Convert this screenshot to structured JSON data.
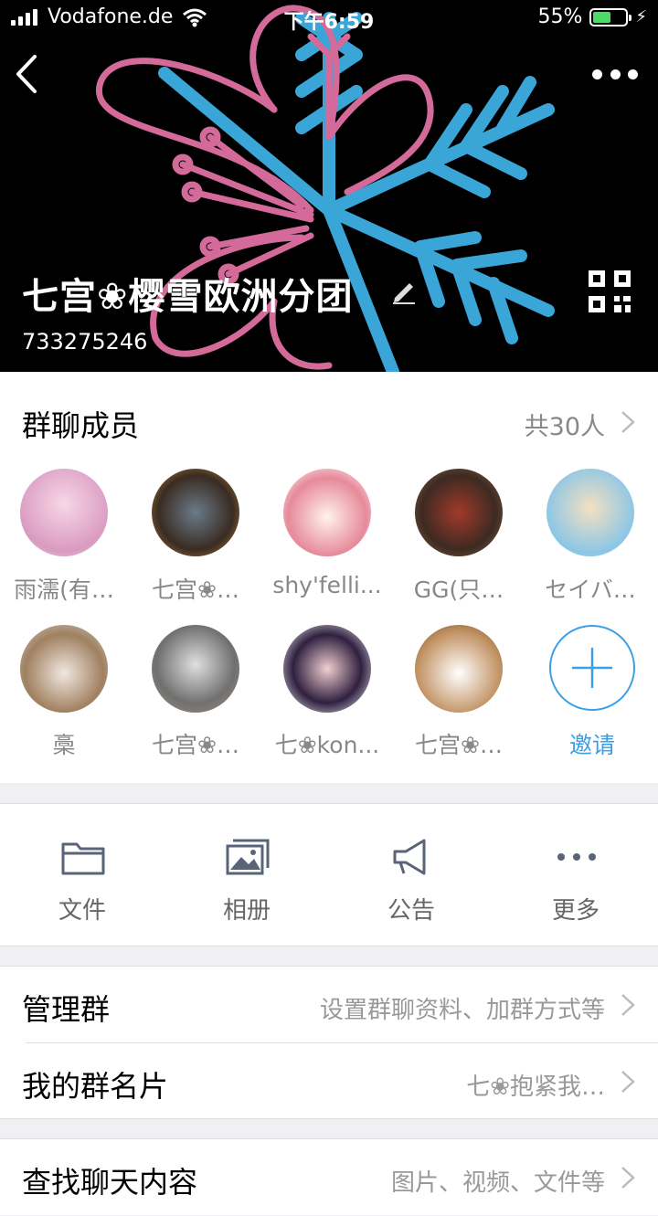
{
  "status_bar": {
    "carrier": "Vodafone.de",
    "time": "下午6:59",
    "battery": "55%",
    "battery_level": 0.55
  },
  "header": {
    "group_name": "七宫❀樱雪欧洲分团",
    "group_id": "733275246"
  },
  "members": {
    "title": "群聊成员",
    "count_label": "共30人",
    "items": [
      {
        "name": "雨濡(有…"
      },
      {
        "name": "七宫❀…"
      },
      {
        "name": "shy'felli..."
      },
      {
        "name": "GG(只…"
      },
      {
        "name": "セイバ…"
      },
      {
        "name": "槀"
      },
      {
        "name": "七宫❀…"
      },
      {
        "name": "七❀kon..."
      },
      {
        "name": "七宫❀…"
      }
    ],
    "invite_label": "邀请"
  },
  "actions": [
    {
      "label": "文件",
      "icon": "folder-icon"
    },
    {
      "label": "相册",
      "icon": "album-icon"
    },
    {
      "label": "公告",
      "icon": "megaphone-icon"
    },
    {
      "label": "更多",
      "icon": "more-dots-icon"
    }
  ],
  "settings": {
    "manage": {
      "label": "管理群",
      "value": "设置群聊资料、加群方式等"
    },
    "card": {
      "label": "我的群名片",
      "value": "七❀抱紧我…"
    },
    "search": {
      "label": "查找聊天内容",
      "value": "图片、视频、文件等"
    }
  },
  "colors": {
    "accent": "#3b9fe6",
    "pink": "#d46a9a",
    "cyan": "#3aa6d8"
  }
}
